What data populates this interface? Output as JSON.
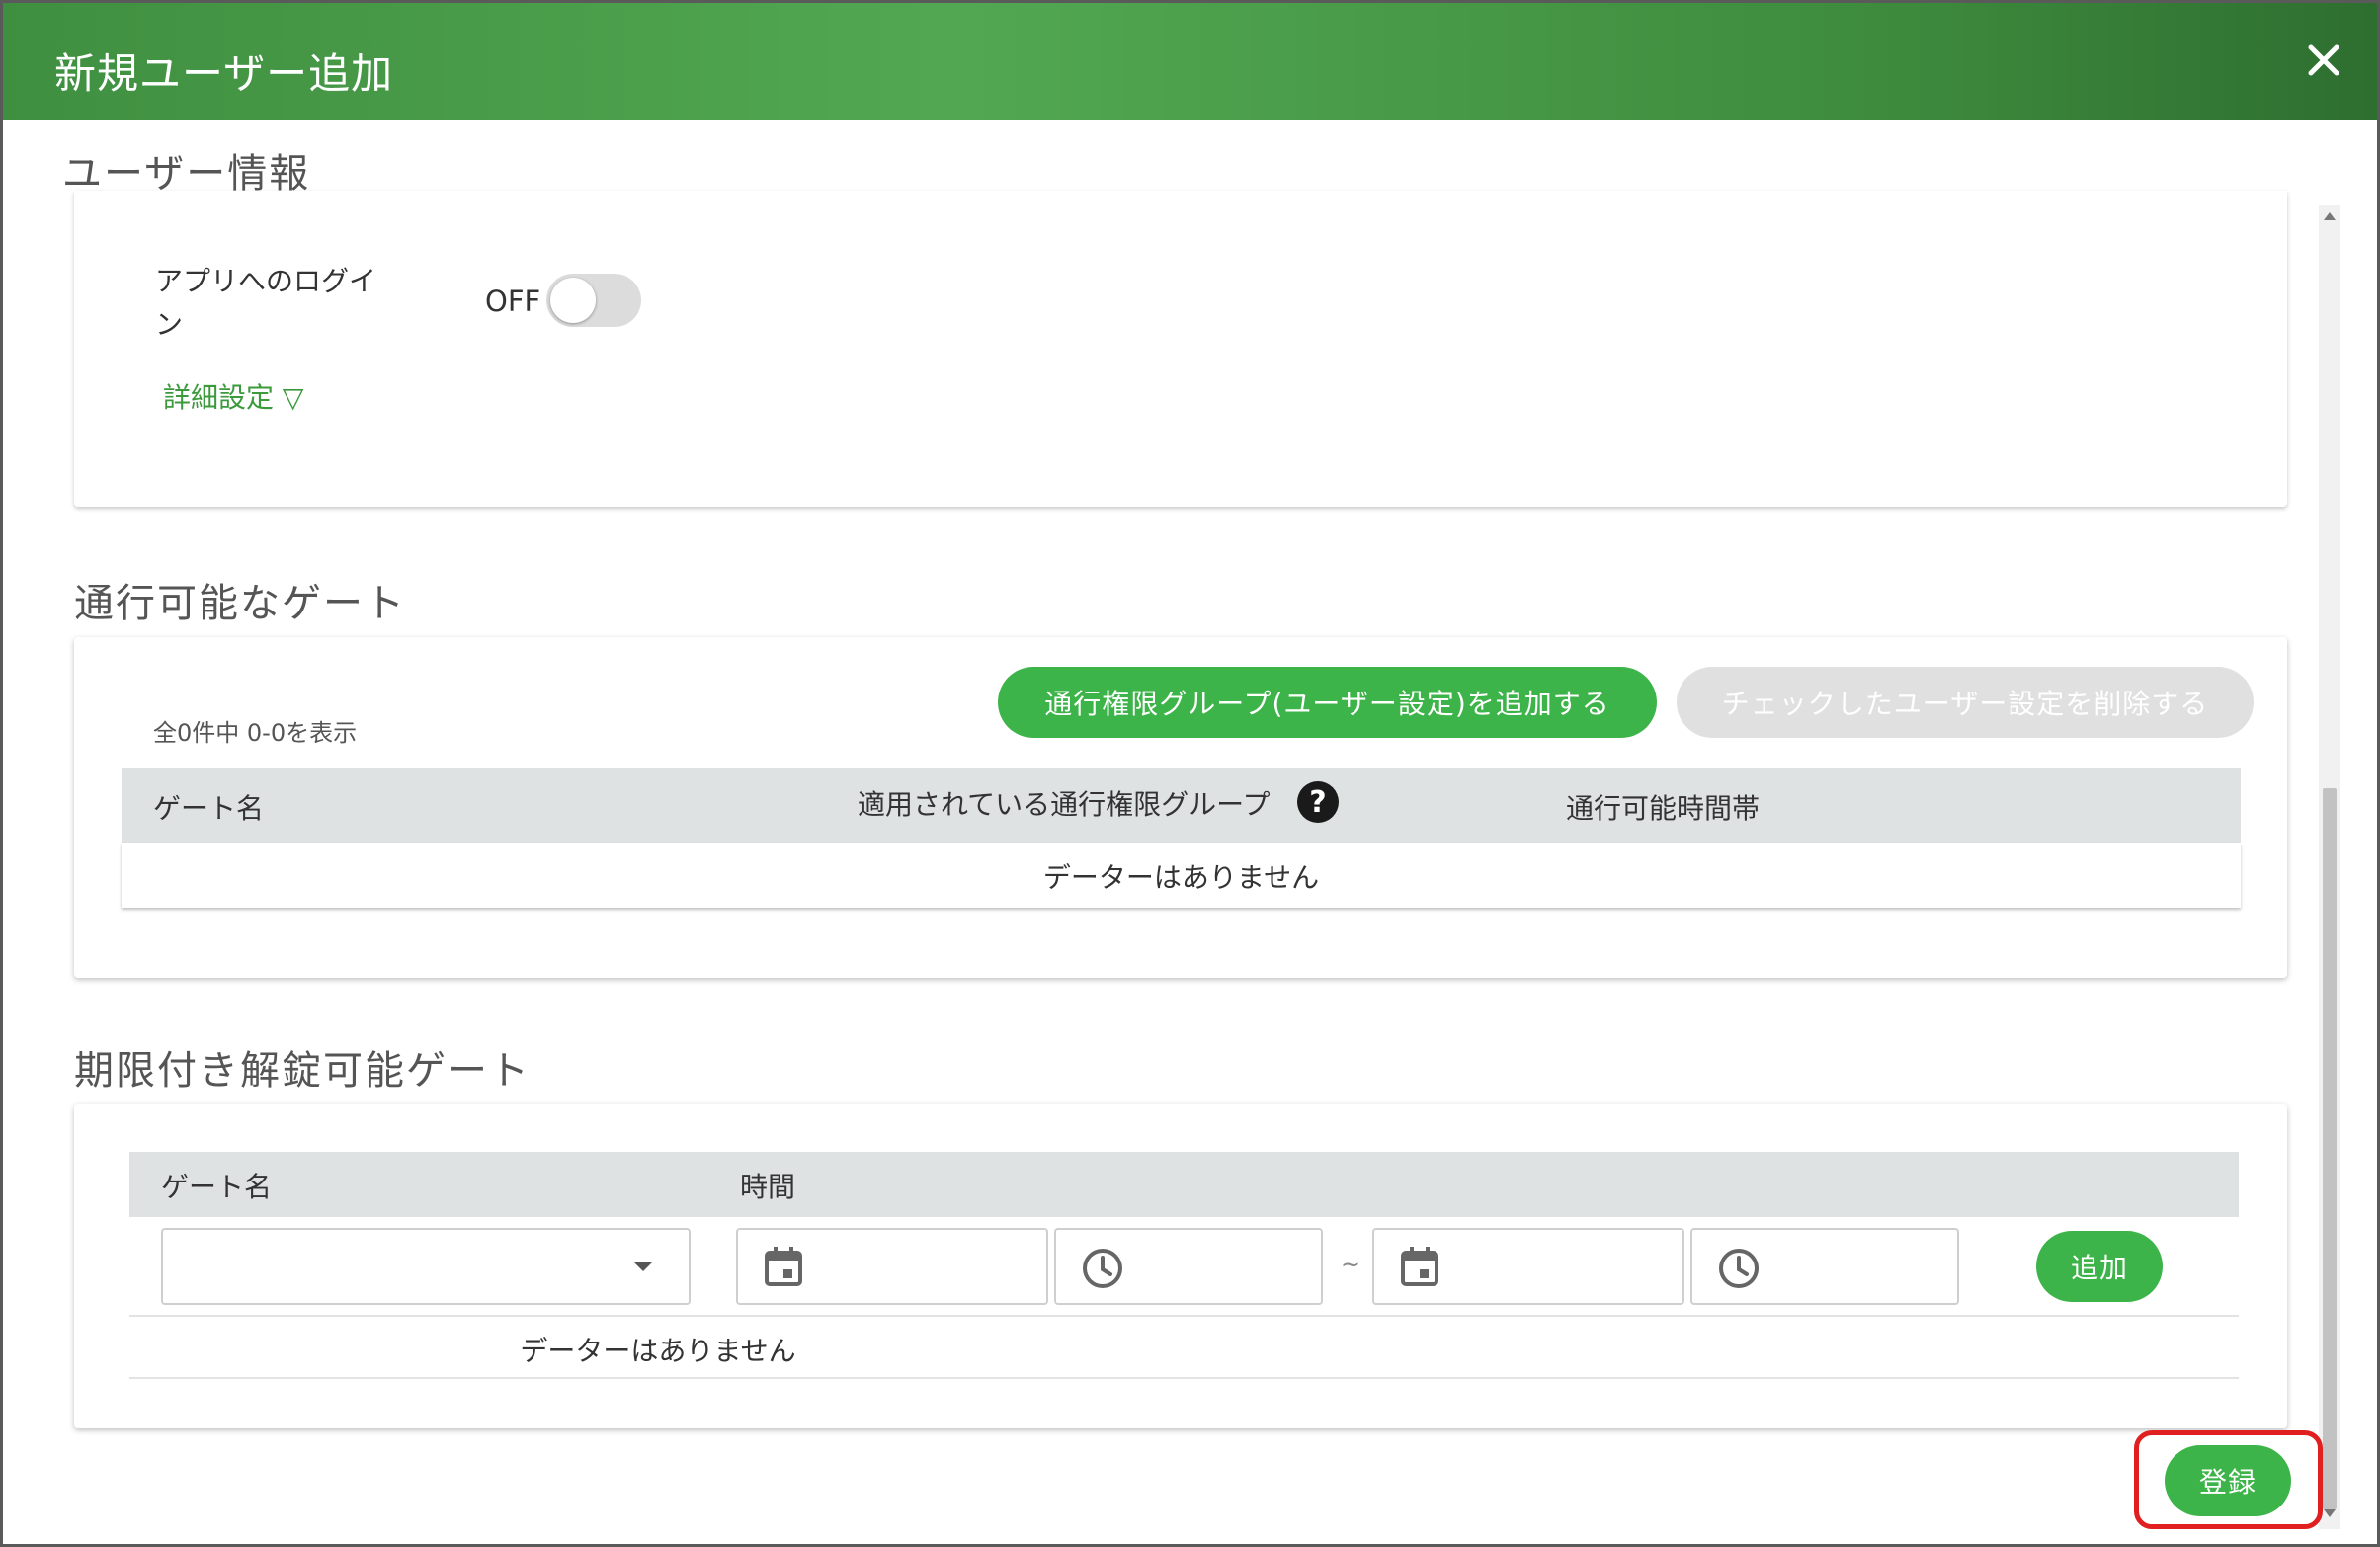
{
  "dialog": {
    "title": "新規ユーザー追加",
    "close_icon": "close-icon"
  },
  "user_info": {
    "heading": "ユーザー情報",
    "app_login_label_line1": "アプリへのログイ",
    "app_login_label_line2": "ン",
    "toggle_state": "OFF",
    "advanced_link": "詳細設定 ▽"
  },
  "gates": {
    "heading": "通行可能なゲート",
    "count_text": "全0件中 0-0を表示",
    "add_button": "通行権限グループ(ユーザー設定)を追加する",
    "delete_button": "チェックしたユーザー設定を削除する",
    "columns": [
      "ゲート名",
      "適用されている通行権限グループ",
      "通行可能時間帯"
    ],
    "help_icon": "?",
    "empty_text": "データーはありません"
  },
  "timed_unlock": {
    "heading": "期限付き解錠可能ゲート",
    "columns": [
      "ゲート名",
      "時間"
    ],
    "separator": "~",
    "add_button": "追加",
    "empty_text": "データーはありません"
  },
  "footer": {
    "register_button": "登録"
  },
  "colors": {
    "header_green": "#4a9e4a",
    "button_green": "#3db449",
    "highlight_red": "#e02020"
  }
}
